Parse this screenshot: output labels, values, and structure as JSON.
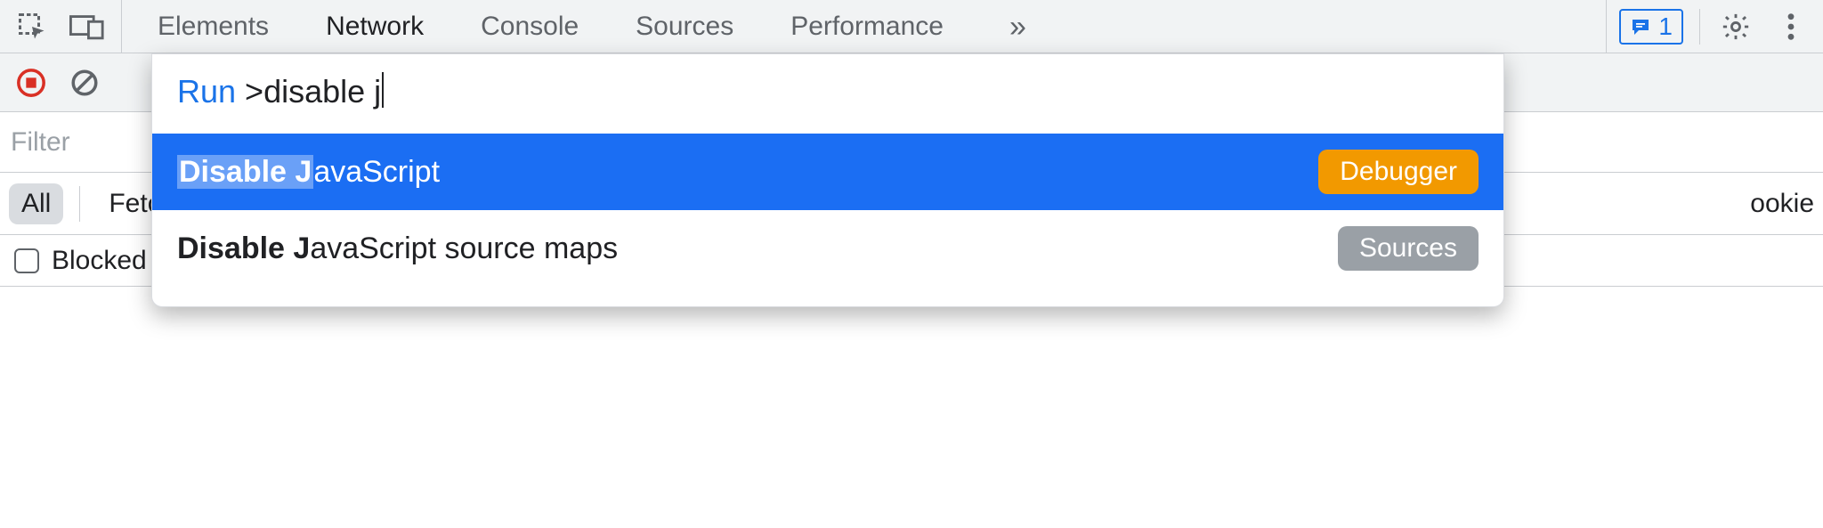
{
  "tabs": {
    "elements": "Elements",
    "network": "Network",
    "console": "Console",
    "sources": "Sources",
    "performance": "Performance"
  },
  "issues": {
    "count": "1"
  },
  "filter": {
    "placeholder": "Filter"
  },
  "chips": {
    "all": "All",
    "fetch": "Fetch",
    "right_edge": "ookie"
  },
  "blocked": {
    "label": "Blocked"
  },
  "palette": {
    "run_label": "Run",
    "query_prefix": ">",
    "query_text": "disable j",
    "items": [
      {
        "match": "Disable J",
        "rest": "avaScript",
        "badge": "Debugger",
        "badge_kind": "debugger",
        "selected": true
      },
      {
        "match": "Disable J",
        "rest": "avaScript source maps",
        "badge": "Sources",
        "badge_kind": "sources",
        "selected": false
      }
    ]
  }
}
